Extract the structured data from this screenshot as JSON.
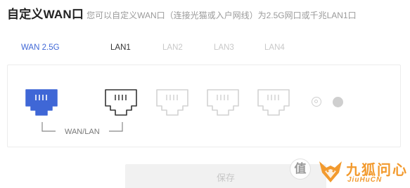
{
  "header": {
    "title": "自定义WAN口",
    "subtitle": "您可以自定义WAN口（连接光猫或入户网线）为2.5G网口或千兆LAN1口"
  },
  "ports": {
    "wan": "WAN 2.5G",
    "lan1": "LAN1",
    "lan2": "LAN2",
    "lan3": "LAN3",
    "lan4": "LAN4",
    "selected": "WAN 2.5G"
  },
  "panel": {
    "bracket_label": "WAN/LAN"
  },
  "actions": {
    "save_label": "保存"
  },
  "watermark": {
    "zhi": "值",
    "cn": "九狐问心",
    "en": "JiuHuCN"
  },
  "colors": {
    "accent": "#3f67d6",
    "port_active_fill": "#3f67d6",
    "port_outline": "#333333",
    "port_disabled": "#d2d2d2",
    "watermark": "#f29a2e"
  },
  "icons": {
    "wan_port": "ethernet-port-icon",
    "lan_port": "ethernet-port-icon",
    "led_ring": "indicator-ring-icon",
    "led_dot": "indicator-dot-icon",
    "fox": "fox-logo-icon"
  }
}
